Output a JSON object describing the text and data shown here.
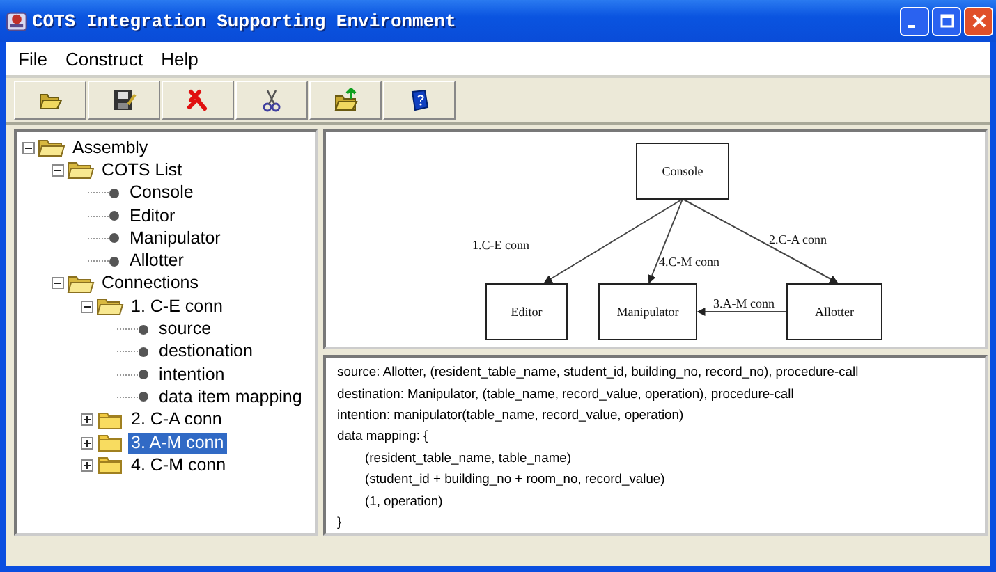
{
  "window": {
    "title": "COTS Integration Supporting Environment"
  },
  "menu": [
    "File",
    "Construct",
    "Help"
  ],
  "tree": [
    {
      "label": "Assembly",
      "kind": "folder",
      "expanded": true,
      "selected": false,
      "children": [
        {
          "label": "COTS List",
          "kind": "folder",
          "expanded": true,
          "selected": false,
          "children": [
            {
              "label": "Console",
              "kind": "leaf",
              "selected": false
            },
            {
              "label": "Editor",
              "kind": "leaf",
              "selected": false
            },
            {
              "label": "Manipulator",
              "kind": "leaf",
              "selected": false
            },
            {
              "label": "Allotter",
              "kind": "leaf",
              "selected": false
            }
          ]
        },
        {
          "label": "Connections",
          "kind": "folder",
          "expanded": true,
          "selected": false,
          "children": [
            {
              "label": "1. C-E conn",
              "kind": "folder",
              "expanded": true,
              "selected": false,
              "children": [
                {
                  "label": "source",
                  "kind": "leaf",
                  "selected": false
                },
                {
                  "label": "destionation",
                  "kind": "leaf",
                  "selected": false
                },
                {
                  "label": "intention",
                  "kind": "leaf",
                  "selected": false
                },
                {
                  "label": "data item mapping",
                  "kind": "leaf",
                  "selected": false
                }
              ]
            },
            {
              "label": "2. C-A conn",
              "kind": "folder",
              "expanded": false,
              "selected": false
            },
            {
              "label": "3. A-M conn",
              "kind": "folder",
              "expanded": false,
              "selected": true
            },
            {
              "label": "4. C-M conn",
              "kind": "folder",
              "expanded": false,
              "selected": false
            }
          ]
        }
      ]
    }
  ],
  "diagram": {
    "nodes": [
      "Console",
      "Editor",
      "Manipulator",
      "Allotter"
    ],
    "edges": [
      "1.C-E conn",
      "4.C-M conn",
      "2.C-A conn",
      "3.A-M conn"
    ]
  },
  "details": [
    {
      "text": "source: Allotter, (resident_table_name, student_id, building_no, record_no), procedure-call",
      "kind": "plain"
    },
    {
      "text": "destination: Manipulator, (table_name, record_value, operation), procedure-call",
      "kind": "plain"
    },
    {
      "text": "intention: manipulator(table_name, record_value, operation)",
      "kind": "plain"
    },
    {
      "text": "data mapping: {",
      "kind": "plain"
    },
    {
      "text": "(resident_table_name, table_name)",
      "kind": "indented"
    },
    {
      "text": "(student_id + building_no + room_no, record_value)",
      "kind": "indented"
    },
    {
      "text": "(1, operation)",
      "kind": "indented"
    },
    {
      "text": "}",
      "kind": "plain"
    }
  ]
}
